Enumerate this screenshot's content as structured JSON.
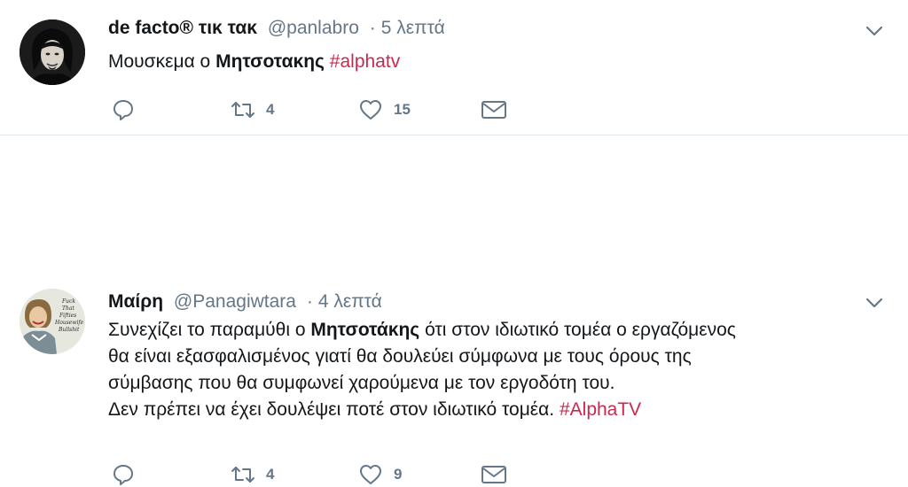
{
  "tweets": [
    {
      "name": "de facto® τικ τακ",
      "handle": "@panlabro",
      "time": "5 λεπτά",
      "separator": "·",
      "body": {
        "t1": "Μουσκεμα ο ",
        "b1": "Μητσοτακης",
        "t2": " ",
        "hashtag": "#alphatv"
      },
      "retweets": "4",
      "likes": "15",
      "icons": [
        "reply-icon",
        "retweet-icon",
        "like-icon",
        "direct-message-icon",
        "chevron-down-icon"
      ]
    },
    {
      "name": "Μαίρη",
      "handle": "@Panagiwtara",
      "time": "4 λεπτά",
      "separator": "·",
      "body": {
        "line1_a": "Συνεχίζει το παραμύθι ο ",
        "line1_b": "Μητσοτάκης",
        "line1_c": " ότι στον ιδιωτικό τομέα ο εργαζόμενος",
        "line2": "θα είναι εξασφαλισμένος γιατί θα δουλεύει σύμφωνα με τους όρους της",
        "line3": "σύμβασης που θα συμφωνεί χαρούμενα με τον εργοδότη του.",
        "line4": "Δεν πρέπει να έχει δουλέψει ποτέ στον ιδιωτικό τομέα. ",
        "hashtag": "#AlphaTV"
      },
      "retweets": "4",
      "likes": "9",
      "avatar_text": [
        "Fuck",
        "That",
        "Fifties",
        "Housewife",
        "Bullshit"
      ]
    }
  ],
  "colors": {
    "text": "#14171a",
    "meta": "#657786",
    "hashtag": "#c9294f",
    "divider": "#e1e8ed"
  }
}
